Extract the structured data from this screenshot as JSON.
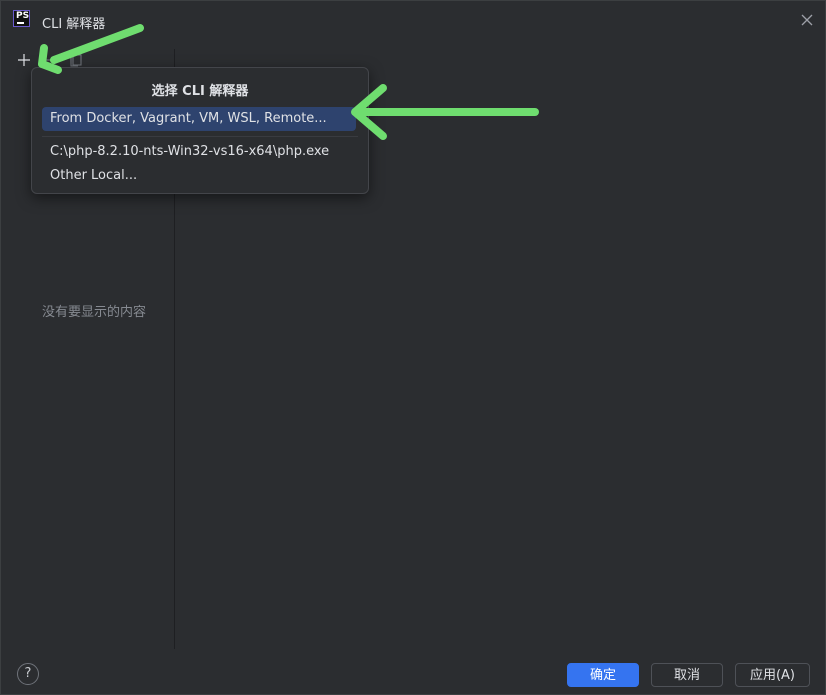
{
  "window": {
    "title": "CLI 解释器",
    "app_icon_label": "PS"
  },
  "toolbar": {
    "add_icon": "plus-icon",
    "remove_icon": "minus-icon",
    "copy_icon": "copy-icon"
  },
  "left_panel": {
    "empty_text": "没有要显示的内容"
  },
  "popup": {
    "title": "选择 CLI 解释器",
    "items": [
      {
        "label": "From Docker, Vagrant, VM, WSL, Remote..."
      },
      {
        "label": "C:\\php-8.2.10-nts-Win32-vs16-x64\\php.exe"
      },
      {
        "label": "Other Local..."
      }
    ]
  },
  "footer": {
    "help_label": "?",
    "ok_label": "确定",
    "cancel_label": "取消",
    "apply_label": "应用(A)"
  },
  "colors": {
    "accent": "#3574f0",
    "selection": "#2e436e",
    "annotation_arrow": "#6fdd6f"
  }
}
